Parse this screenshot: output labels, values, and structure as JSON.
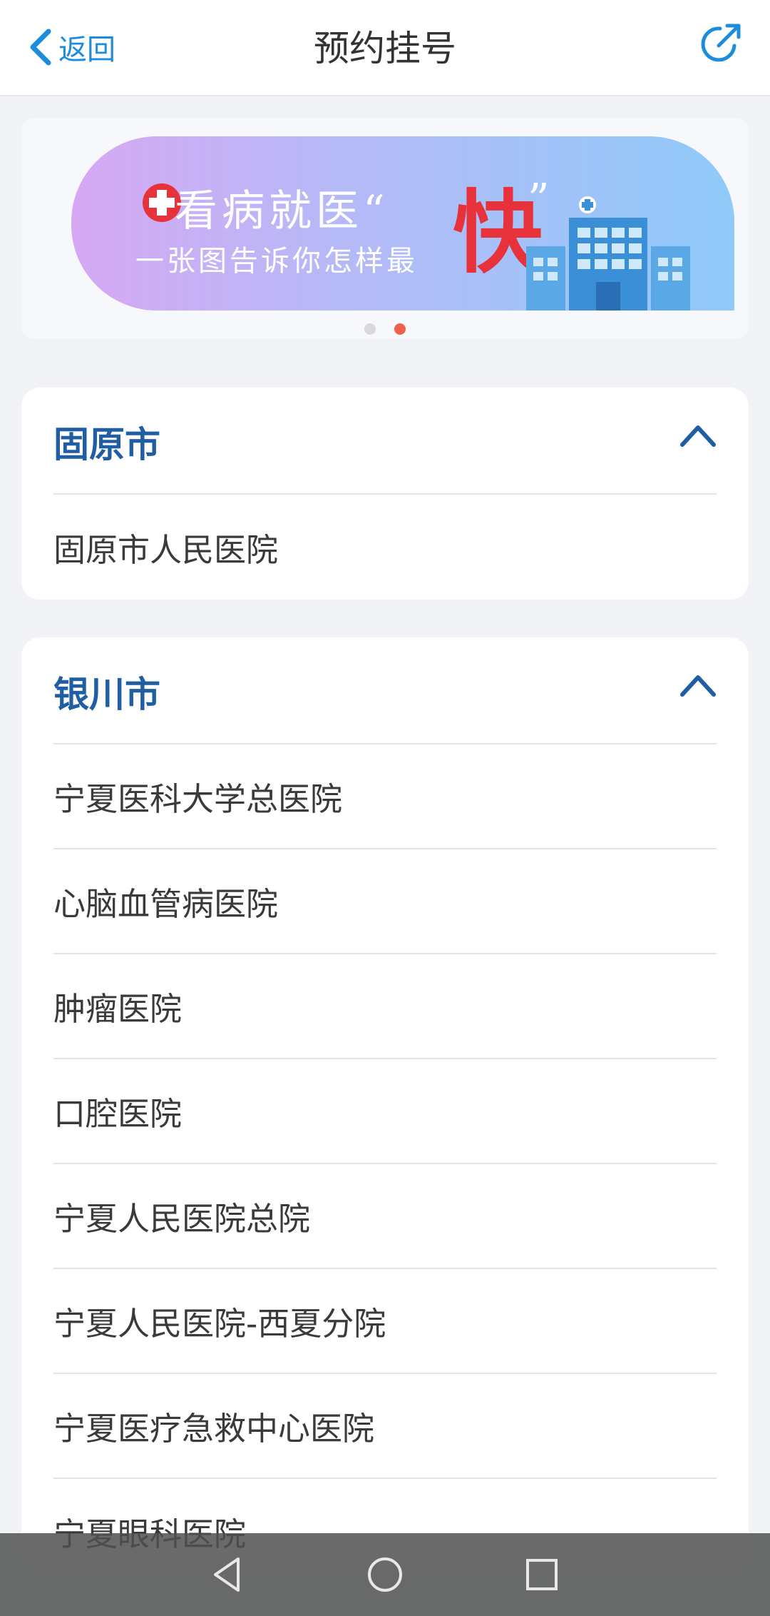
{
  "header": {
    "back_label": "返回",
    "title": "预约挂号"
  },
  "banner": {
    "line1": "看病就医“",
    "quote_close": "”",
    "line2": "一张图告诉你怎样最",
    "highlight": "快",
    "highlight_color": "#e8323b",
    "active_dot": 2,
    "dot_count": 2
  },
  "sections": [
    {
      "city": "固原市",
      "hospitals": [
        "固原市人民医院"
      ]
    },
    {
      "city": "银川市",
      "hospitals": [
        "宁夏医科大学总医院",
        "心脑血管病医院",
        "肿瘤医院",
        "口腔医院",
        "宁夏人民医院总院",
        "宁夏人民医院-西夏分院",
        "宁夏医疗急救中心医院",
        "宁夏眼科医院"
      ]
    }
  ],
  "colors": {
    "accent": "#1b8ddc",
    "city_title": "#1f5ea3",
    "background": "#f2f3f7"
  }
}
